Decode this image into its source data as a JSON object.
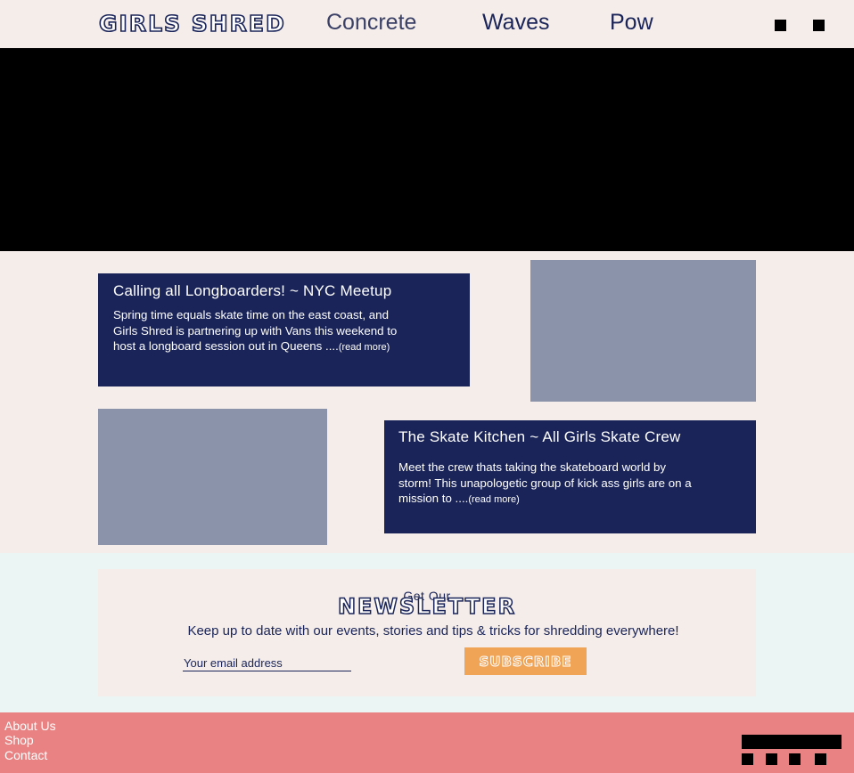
{
  "header": {
    "logo": "GIRLS SHRED",
    "nav": [
      "Concrete",
      "Waves",
      "Pow"
    ]
  },
  "header_icons": [
    "cart-icon",
    "menu-icon"
  ],
  "posts": [
    {
      "title": "Calling all Longboarders! ~ NYC Meetup",
      "body_lines": [
        "Spring time equals skate time on the east coast, and",
        "Girls Shred is partnering up with Vans this weekend to",
        "host a longboard session out in Queens ...."
      ],
      "read_more": "(read more)"
    },
    {
      "title": "The Skate Kitchen ~ All Girls Skate Crew",
      "body_lines": [
        "Meet the crew thats taking the skateboard world by",
        "storm! This unapologetic group of kick ass girls are on a",
        "mission to ...."
      ],
      "read_more": "(read more)"
    }
  ],
  "newsletter": {
    "pre": "Get Our",
    "title": "NEWSLETTER",
    "description": "Keep up to date with our events, stories and tips & tricks for shredding everywhere!",
    "email_placeholder": "Your email address",
    "subscribe_label": "SUBSCRIBE"
  },
  "footer": {
    "links": [
      "About Us",
      "Shop",
      "Contact"
    ],
    "social_icons": [
      "facebook-icon",
      "twitter-icon",
      "instagram-icon",
      "pinterest-icon"
    ]
  },
  "colors": {
    "navy": "#1a2458",
    "cream": "#f4edea",
    "mint": "#eaf5f4",
    "coral": "#e98282",
    "orange": "#f0a456",
    "image_placeholder": "#8a93aa"
  }
}
